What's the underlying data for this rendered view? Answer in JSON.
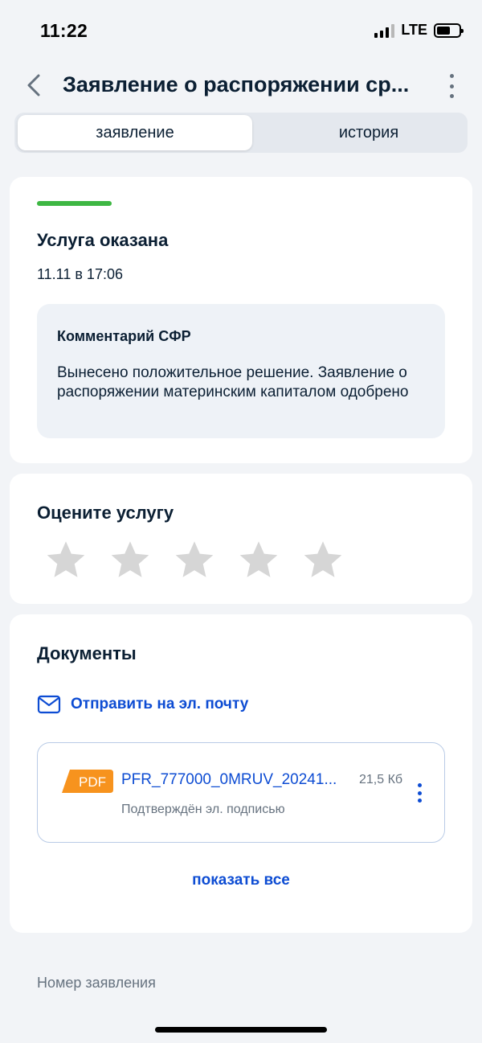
{
  "status_bar": {
    "time": "11:22",
    "network": "LTE",
    "battery_level": 0.6
  },
  "header": {
    "title": "Заявление о распоряжении ср...",
    "back_icon": "chevron-left-icon",
    "more_icon": "more-vertical-icon"
  },
  "tabs": [
    {
      "label": "заявление",
      "active": true
    },
    {
      "label": "история",
      "active": false
    }
  ],
  "status_card": {
    "title": "Услуга оказана",
    "date": "11.11 в 17:06",
    "status_color": "#3eb743",
    "comment": {
      "title": "Комментарий СФР",
      "text": "Вынесено положительное решение. Заявление о распоряжении материнским капиталом одобрено"
    }
  },
  "rating_card": {
    "title": "Оцените услугу",
    "star_count": 5,
    "rating": 0
  },
  "documents_card": {
    "title": "Документы",
    "email_link": "Отправить на эл. почту",
    "email_icon": "mail-icon",
    "items": [
      {
        "type": "PDF",
        "name": "PFR_777000_0MRUV_20241...",
        "size": "21,5 Кб",
        "signed": "Подтверждён эл. подписью"
      }
    ],
    "show_all": "показать все"
  },
  "footer": {
    "application_number_label": "Номер заявления"
  },
  "colors": {
    "accent": "#0d4cd3",
    "success": "#3eb743",
    "pdf": "#f7931e",
    "star_inactive": "#d6d6d6"
  }
}
